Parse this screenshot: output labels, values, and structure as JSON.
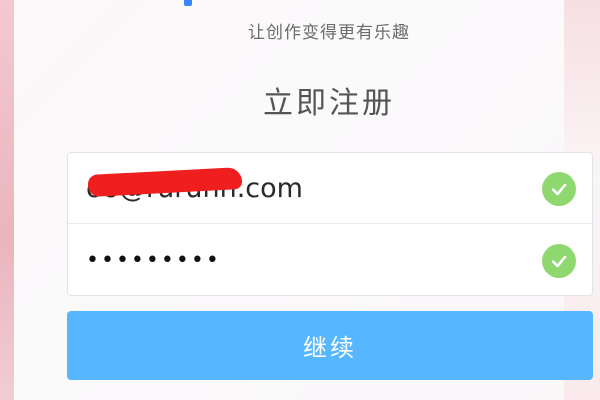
{
  "header": {
    "tagline": "让创作变得更有乐趣",
    "title": "立即注册"
  },
  "form": {
    "email_value": "oo@ruruhh.com",
    "email_status_icon": "check-circle-icon",
    "password_value": "•••••••••",
    "password_status_icon": "check-circle-icon",
    "continue_label": "继续"
  },
  "colors": {
    "button": "#56b7ff",
    "check": "#8fd86f",
    "redaction": "#ef1f1f"
  }
}
